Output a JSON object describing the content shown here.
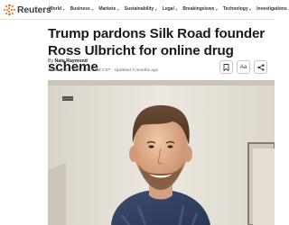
{
  "brand": {
    "name": "Reuters",
    "accent": "#fa6400"
  },
  "nav": {
    "items": [
      {
        "label": "World",
        "icon": "chevron-down-icon"
      },
      {
        "label": "Business",
        "icon": "chevron-down-icon"
      },
      {
        "label": "Markets",
        "icon": "chevron-down-icon"
      },
      {
        "label": "Sustainability",
        "icon": "chevron-down-icon"
      },
      {
        "label": "Legal",
        "icon": "chevron-down-icon"
      },
      {
        "label": "Breakingviews",
        "icon": "chevron-down-icon"
      },
      {
        "label": "Technology",
        "icon": "chevron-down-icon"
      },
      {
        "label": "Investigations",
        "icon": "chevron-down-icon"
      }
    ]
  },
  "article": {
    "headline": "Trump pardons Silk Road founder Ross Ulbricht for online drug scheme",
    "byline_prefix": "By",
    "author": "Nate Raymond",
    "dateline": "January 22, 2025 10:17 AM CST · Updated 3 months ago",
    "actions": {
      "bookmark_icon": "bookmark-icon",
      "text_size_label": "Aa",
      "share_icon": "share-icon"
    }
  }
}
